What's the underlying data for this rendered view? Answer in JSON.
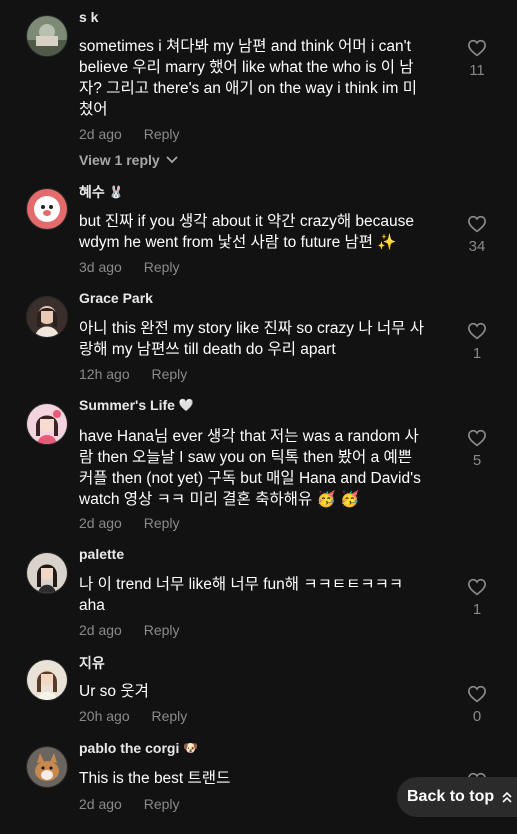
{
  "comments": [
    {
      "username": "s k",
      "name_emoji": "",
      "lines": [
        "sometimes i 쳐다봐 my 남편 and think 어머 i can't",
        "believe 우리 marry 했어 like what the who is 이 남",
        "자? 그리고 there's an 애기 on the way i think im 미",
        "쳤어"
      ],
      "time": "2d ago",
      "reply_label": "Reply",
      "likes": "11",
      "view_replies": "View 1 reply"
    },
    {
      "username": "혜수",
      "name_emoji": "🐰",
      "lines": [
        "but 진짜 if you 생각 about it 약간 crazy해 because",
        "wdym he went from 낯선 사람 to future 남편 ✨"
      ],
      "time": "3d ago",
      "reply_label": "Reply",
      "likes": "34"
    },
    {
      "username": "Grace Park",
      "name_emoji": "",
      "lines": [
        "아니 this 완전 my story like 진짜 so crazy 나 너무 사",
        "랑해 my 남편쓰 till death do 우리 apart"
      ],
      "time": "12h ago",
      "reply_label": "Reply",
      "likes": "1"
    },
    {
      "username": "Summer's Life",
      "name_emoji": "🤍",
      "lines": [
        "have Hana님 ever 생각 that 저는 was a random 사",
        "람 then 오늘날 I saw you on 틱톡 then 봤어 a 예쁜",
        "커플 then (not yet) 구독 but 매일 Hana and David's",
        "watch 영상 ㅋㅋ 미리 결혼 축하해유 🥳 🥳"
      ],
      "time": "2d ago",
      "reply_label": "Reply",
      "likes": "5"
    },
    {
      "username": "palette",
      "name_emoji": "",
      "lines": [
        "나 이 trend 너무 like해 너무 fun해 ㅋㅋㅌㅌㅋㅋㅋ",
        "aha"
      ],
      "time": "2d ago",
      "reply_label": "Reply",
      "likes": "1"
    },
    {
      "username": "지유",
      "name_emoji": "",
      "lines": [
        "Ur so 웃겨"
      ],
      "time": "20h ago",
      "reply_label": "Reply",
      "likes": "0"
    },
    {
      "username": "pablo the corgi",
      "name_emoji": "🐶",
      "lines": [
        "This is the best 트랜드"
      ],
      "time": "2d ago",
      "reply_label": "Reply",
      "likes": ""
    }
  ],
  "back_to_top": "Back to top",
  "icons": {
    "like": "heart-outline-icon",
    "expand": "chevron-down-icon",
    "back_to_top": "double-chevron-up-icon"
  },
  "colors": {
    "background": "#121212",
    "text": "#ffffff",
    "muted": "#8a8a8a"
  }
}
